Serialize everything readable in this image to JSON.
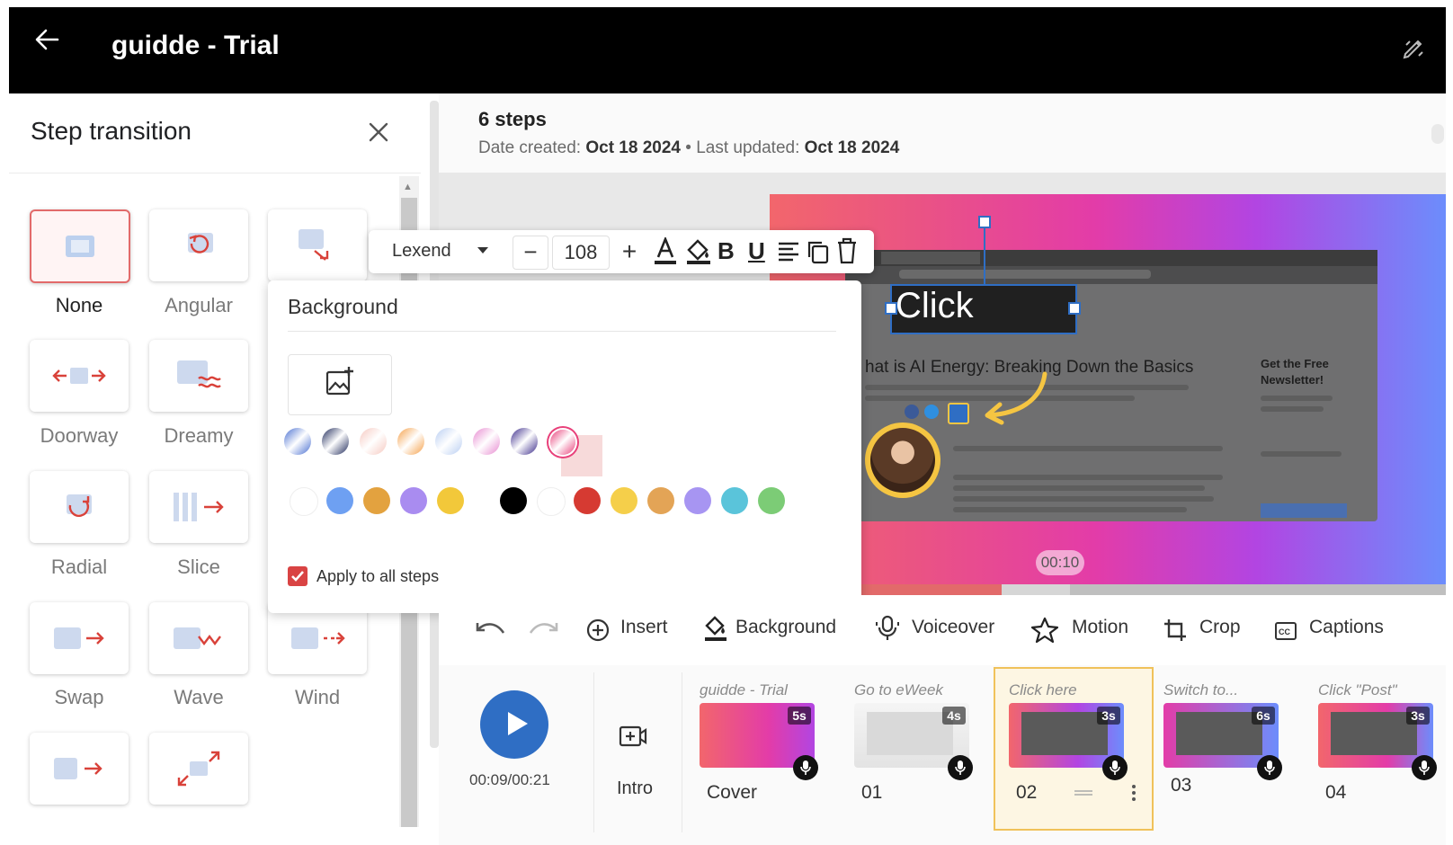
{
  "app": {
    "title": "guidde - Trial"
  },
  "panel": {
    "title": "Step transition",
    "transitions": [
      {
        "label": "None",
        "icon": "none-transition-icon",
        "selected": true
      },
      {
        "label": "Angular",
        "icon": "angular-transition-icon"
      },
      {
        "label": "",
        "icon": "transition-icon"
      },
      {
        "label": "Doorway",
        "icon": "doorway-transition-icon"
      },
      {
        "label": "Dreamy",
        "icon": "dreamy-transition-icon"
      },
      {
        "label": "Radial",
        "icon": "radial-transition-icon"
      },
      {
        "label": "Slice",
        "icon": "slice-transition-icon"
      },
      {
        "label": "Swap",
        "icon": "swap-transition-icon"
      },
      {
        "label": "Wave",
        "icon": "wave-transition-icon"
      },
      {
        "label": "Wind",
        "icon": "wind-transition-icon"
      },
      {
        "label": "",
        "icon": "transition-icon"
      },
      {
        "label": "",
        "icon": "zoom-transition-icon"
      }
    ]
  },
  "header": {
    "steps": "6 steps",
    "created_label": "Date created:",
    "created": "Oct 18 2024",
    "separator": "•",
    "updated_label": "Last updated:",
    "updated": "Oct 18 2024"
  },
  "canvas": {
    "click_text": "Click",
    "article_heading": "hat is AI Energy: Breaking Down the Basics",
    "newsletter": "Get the Free Newsletter!",
    "timestamp": "00:10",
    "progress": 0.28
  },
  "text_toolbar": {
    "font": "Lexend",
    "size": "108",
    "minus": "−",
    "plus": "+",
    "bold": "B",
    "underline": "U"
  },
  "background_popover": {
    "title": "Background",
    "apply_label": "Apply to all steps",
    "apply_checked": true,
    "gradient_swatches": [
      "#4a6fd1",
      "#1f2a5a",
      "#f6c9c0",
      "#f5a04a",
      "#b9cef2",
      "#e78ad0",
      "#3a2a8a",
      "#e8407a"
    ],
    "solid_swatches_a": [
      "#ffffff",
      "#6ea0f2",
      "#e3a23f",
      "#a98cf0",
      "#f2c83a"
    ],
    "solid_swatches_b": [
      "#000000",
      "#ffffff",
      "#d63a32",
      "#f5cf4a",
      "#e3a456",
      "#a795f2",
      "#5ac4da",
      "#7ccc76"
    ],
    "selected_index": 7
  },
  "bottom_toolbar": {
    "insert": "Insert",
    "background": "Background",
    "voiceover": "Voiceover",
    "motion": "Motion",
    "crop": "Crop",
    "captions": "Captions"
  },
  "timeline": {
    "timecode": "00:09/00:21",
    "intro": "Intro",
    "steps": [
      {
        "title": "guidde - Trial",
        "duration": "5s",
        "label": "Cover"
      },
      {
        "title": "Go to eWeek",
        "duration": "4s",
        "label": "01"
      },
      {
        "title": "Click here",
        "duration": "3s",
        "label": "02",
        "selected": true
      },
      {
        "title": "Switch to...",
        "duration": "6s",
        "label": "03"
      },
      {
        "title": "Click \"Post\"",
        "duration": "3s",
        "label": "04"
      }
    ]
  }
}
